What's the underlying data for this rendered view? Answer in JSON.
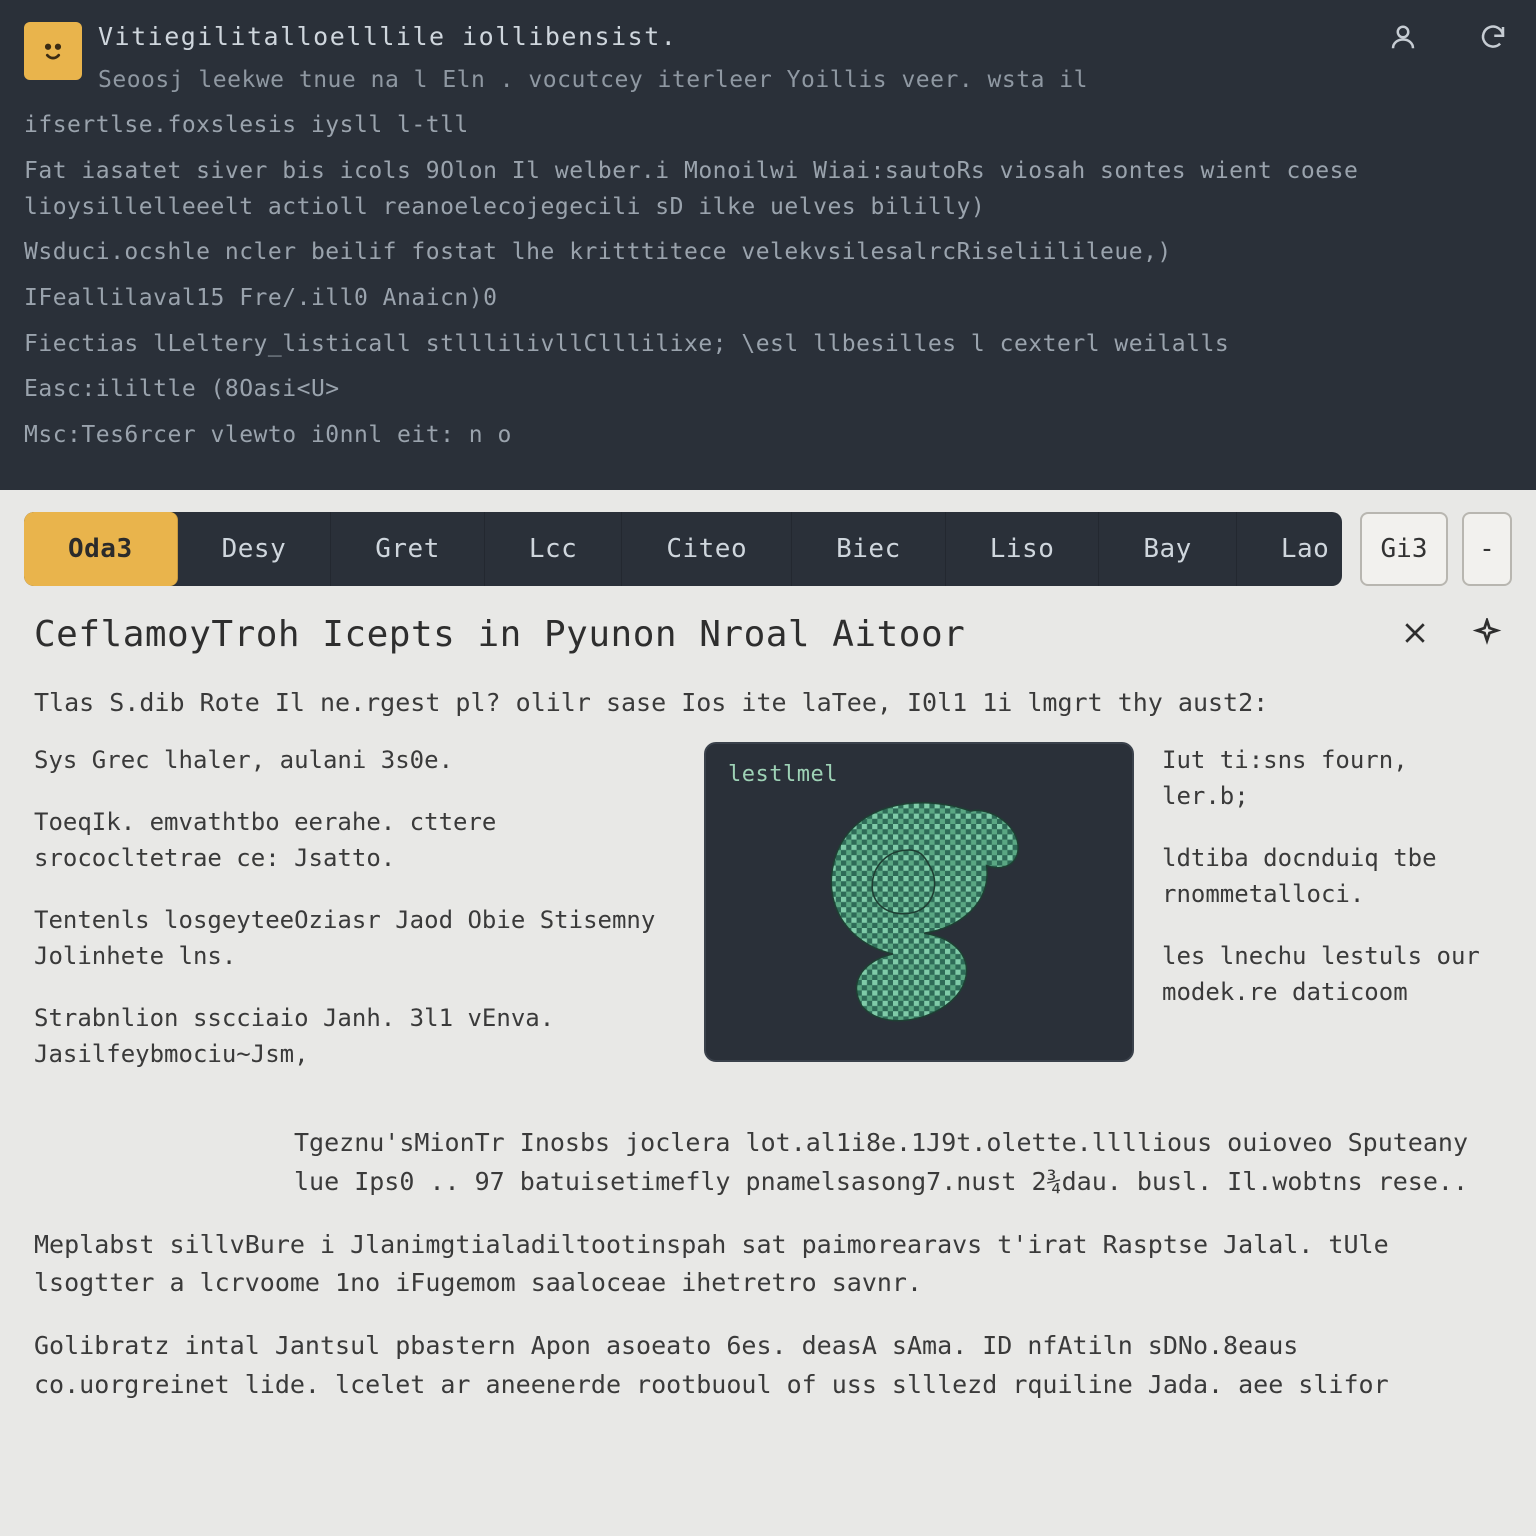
{
  "terminal": {
    "title": "Vitiegilitalloelllile iollibensist.",
    "subtitle": "Seoosj leekwe tnue na l Eln . vocutcey iterleer Yoillis veer. wsta il",
    "lines": [
      "ifsertlse.foxslesis iysll l-tll",
      "Fat iasatet siver bis icols 9Olon Il welber.i Monoilwi Wiai:sautoRs viosah sontes wient coese lioysillelleeelt actioll reanoelecojegecili sD ilke uelves bililly)",
      "Wsduci.ocshle ncler beilif fostat lhe kritttitece  velekvsilesalrcRiseliilileue,)",
      "IFeallilaval15 Fre/.ill0 Anaicn)0",
      "Fiectias lLeltery_listicall stlllilivllClllilixe; \\esl llbesilles l cexterl weilalls",
      "Easc:ililtle (8Oasi<U>",
      "Msc:Tes6rcer vlewto i0nnl eit: n o"
    ]
  },
  "tabs": {
    "items": [
      "Oda3",
      "Desy",
      "Gret",
      "Lcc",
      "Citeo",
      "Biec",
      "Liso",
      "Bay",
      "Lao"
    ],
    "active_index": 0,
    "right_button": "Gi3",
    "right_ellipsis": "-"
  },
  "article": {
    "title": "CeflamoyTroh Icepts in Pyunon Nroal Aitoor",
    "intro": "Tlas S.dib Rote Il ne.rgest pl? olilr sase Ios ite laTee, I0l1 1i lmgrt thy aust2:",
    "left_col": [
      "Sys Grec lhaler, aulani 3s0e.",
      "ToeqIk. emvathtbo eerahe. cttere srococltetrae ce: Jsatto.",
      "Tentenls losgeyteeOziasr Jaod Obie Stisemny Jolinhete lns.",
      "Strabnlion sscciaio Janh. 3l1 vEnva. Jasilfeybmociu~Jsm,"
    ],
    "hero_label": "lestlmel",
    "right_col": [
      "Iut ti:sns fourn, ler.b;",
      "ldtiba docnduiq tbe rnommetalloci.",
      "les lnechu lestuls our modek.re daticoom"
    ],
    "body": [
      {
        "indent": true,
        "text": "Tgeznu'sMionTr  Inosbs joclera lot.al1i8e.1J9t.olette.llllious ouioveo Sputeany lue Ips0 .. 97 batuisetimefly pnamelsasong7.nust 2¾dau. busl. Il.wobtns rese.."
      },
      {
        "indent": false,
        "text": "Meplabst sillvBure i Jlanimgtialadiltootinspah sat paimorearavs t'irat Rasptse Jalal. tUle lsogtter a lcrvoome 1no iFugemom saaloceae ihetretro savnr."
      },
      {
        "indent": false,
        "text": "Golibratz intal Jantsul pbastern Apon asoeato 6es. deasA sAma. ID nfAtiln sDNo.8eaus co.uorgreinet lide. lcelet ar aneenerde rootbuoul of uss slllezd rquiline Jada. aee slifor"
      }
    ]
  },
  "icons": {
    "user": "user-icon",
    "refresh": "refresh-icon",
    "close": "close-icon",
    "sparkle": "sparkle-icon"
  }
}
